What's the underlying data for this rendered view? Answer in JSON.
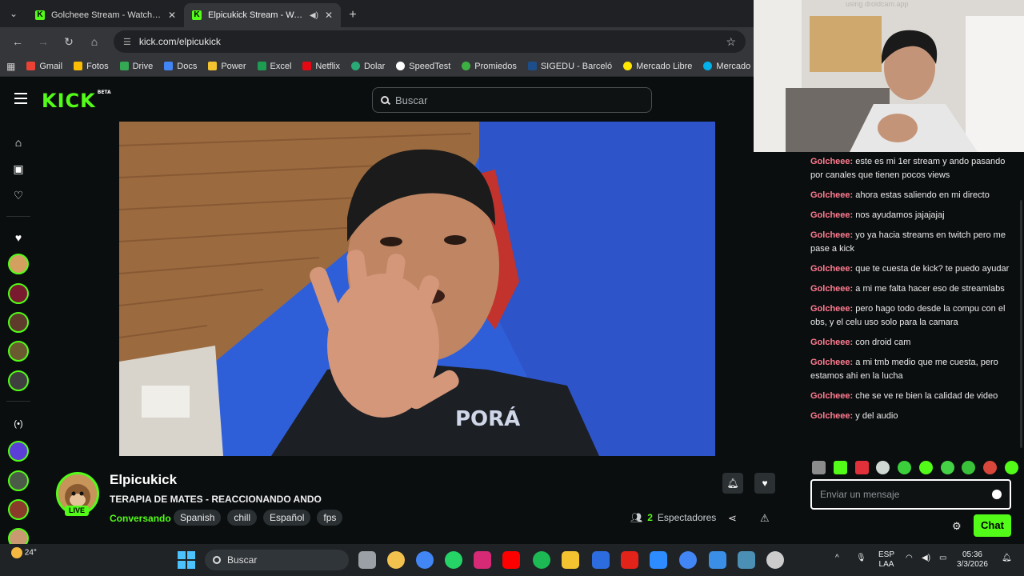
{
  "browser": {
    "tabs": [
      {
        "title": "Golcheee Stream - Watch Live o",
        "active": false
      },
      {
        "title": "Elpicukick Stream - Watch L",
        "active": true
      }
    ],
    "url": "kick.com/elpicukick",
    "bookmarks": [
      "Gmail",
      "Fotos",
      "Drive",
      "Docs",
      "Power",
      "Excel",
      "Netflix",
      "Dolar",
      "SpeedTest",
      "Promiedos",
      "SIGEDU - Barceló",
      "Mercado Libre",
      "Mercado Pago"
    ]
  },
  "header": {
    "logo": "KICK",
    "logo_tag": "BETA",
    "search_placeholder": "Buscar"
  },
  "stream": {
    "channel": "Elpicukick",
    "live_label": "LIVE",
    "title": "TERAPIA DE MATES - REACCIONANDO ANDO",
    "category": "Conversando",
    "tags": [
      "Spanish",
      "chill",
      "Español",
      "fps"
    ],
    "viewers_count": "2",
    "viewers_label": "Espectadores"
  },
  "chat": {
    "messages": [
      {
        "user": "Golcheee",
        "text": "este es mi 1er stream y ando pasando por canales que tienen pocos views"
      },
      {
        "user": "Golcheee",
        "text": "ahora estas saliendo en mi directo"
      },
      {
        "user": "Golcheee",
        "text": "nos ayudamos jajajajaj"
      },
      {
        "user": "Golcheee",
        "text": "yo ya hacia streams en twitch pero me pase a kick"
      },
      {
        "user": "Golcheee",
        "text": "que te cuesta de kick? te puedo ayudar"
      },
      {
        "user": "Golcheee",
        "text": "a mi me falta hacer eso de streamlabs"
      },
      {
        "user": "Golcheee",
        "text": "pero hago todo desde la compu con el obs, y el celu uso solo para la camara"
      },
      {
        "user": "Golcheee",
        "text": "con droid cam"
      },
      {
        "user": "Golcheee",
        "text": "a mi tmb medio que me cuesta, pero estamos ahi en la lucha"
      },
      {
        "user": "Golcheee",
        "text": "che se ve re bien la calidad de video"
      },
      {
        "user": "Golcheee",
        "text": "y del audio"
      }
    ],
    "input_placeholder": "Enviar un mensaje",
    "send_label": "Chat"
  },
  "webcam": {
    "watermark": "using droidcam.app"
  },
  "taskbar": {
    "weather": "24°",
    "search_label": "Buscar",
    "lang_top": "ESP",
    "lang_bottom": "LAA",
    "time": "05:36",
    "date": "3/3/2026"
  },
  "colors": {
    "kick_green": "#53fc18",
    "chat_user": "#ff7b8f",
    "bg": "#0b0e0f"
  }
}
